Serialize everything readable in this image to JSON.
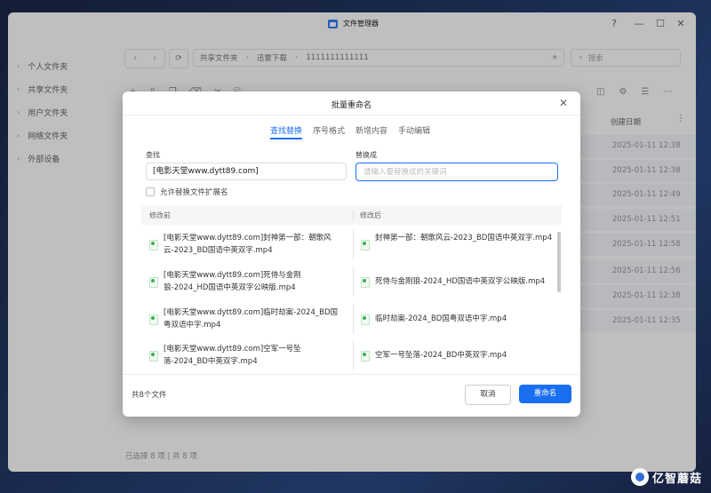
{
  "window": {
    "title": "文件管理器"
  },
  "window_controls": {
    "help": "?",
    "minimize": "—",
    "maximize": "☐",
    "close": "✕"
  },
  "sidebar": {
    "items": [
      {
        "label": "个人文件夹"
      },
      {
        "label": "共享文件夹"
      },
      {
        "label": "用户文件夹"
      },
      {
        "label": "网络文件夹"
      },
      {
        "label": "外部设备"
      }
    ]
  },
  "path": {
    "crumbs": [
      "共享文件夹",
      "迅雷下载",
      "1111111111111"
    ]
  },
  "search": {
    "placeholder": "搜索"
  },
  "file_list": {
    "date_header": "创建日期",
    "dates": [
      "2025-01-11 12:38",
      "2025-01-11 12:38",
      "2025-01-11 12:49",
      "2025-01-11 12:51",
      "2025-01-11 12:58",
      "2025-01-11 12:56",
      "2025-01-11 12:38",
      "2025-01-11 12:35"
    ],
    "selection_status": "已选择 8 项 | 共 8 项"
  },
  "dialog": {
    "title": "批量重命名",
    "tabs": [
      "查找替换",
      "序号格式",
      "新增内容",
      "手动编辑"
    ],
    "active_tab": 0,
    "find_label": "查找",
    "find_value": "[电影天堂www.dytt89.com]",
    "replace_label": "替换成",
    "replace_placeholder": "请输入要替换成的关键词",
    "replace_value": "",
    "allow_ext_label": "允许替换文件扩展名",
    "col_before": "修改前",
    "col_after": "修改后",
    "rows": [
      {
        "before": "[电影天堂www.dytt89.com]封神第一部：朝歌风云-2023_BD国语中英双字.mp4",
        "after": "封神第一部：朝歌风云-2023_BD国语中英双字.mp4"
      },
      {
        "before": "[电影天堂www.dytt89.com]死侍与金刚狼-2024_HD国语中英双字公映版.mp4",
        "after": "死侍与金刚狼-2024_HD国语中英双字公映版.mp4"
      },
      {
        "before": "[电影天堂www.dytt89.com]临时劫案-2024_BD国粤双语中字.mp4",
        "after": "临时劫案-2024_BD国粤双语中字.mp4"
      },
      {
        "before": "[电影天堂www.dytt89.com]空军一号坠落-2024_BD中英双字.mp4",
        "after": "空军一号坠落-2024_BD中英双字.mp4"
      }
    ],
    "count_text": "共8个文件",
    "cancel_label": "取消",
    "confirm_label": "重命名"
  },
  "watermark": {
    "text": "亿智蘑菇"
  }
}
